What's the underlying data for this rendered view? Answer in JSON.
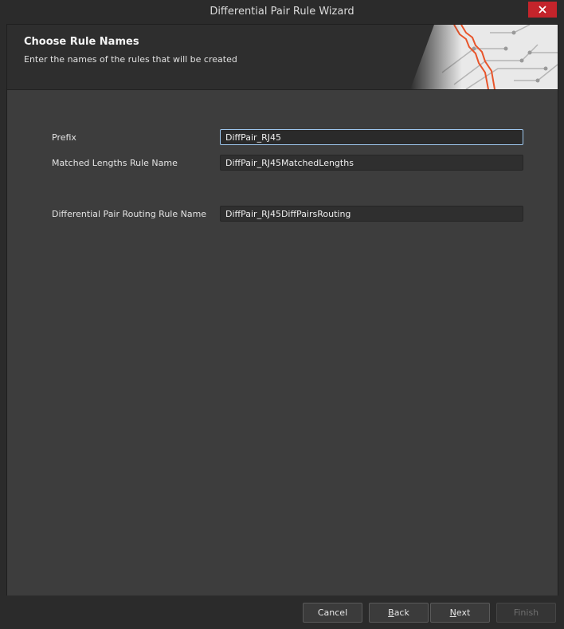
{
  "window": {
    "title": "Differential Pair Rule Wizard"
  },
  "header": {
    "title": "Choose Rule Names",
    "subtitle": "Enter the names of the rules that will be created"
  },
  "fields": {
    "prefix": {
      "label": "Prefix",
      "value": "DiffPair_RJ45"
    },
    "matched_lengths": {
      "label": "Matched Lengths Rule Name",
      "value": "DiffPair_RJ45MatchedLengths"
    },
    "diff_pair_routing": {
      "label": "Differential Pair Routing Rule Name",
      "value": "DiffPair_RJ45DiffPairsRouting"
    }
  },
  "buttons": {
    "cancel": "Cancel",
    "back_first": "B",
    "back_rest": "ack",
    "next_first": "N",
    "next_rest": "ext",
    "finish": "Finish"
  },
  "colors": {
    "accent_close": "#c4242b",
    "circuit_accent": "#e8542a",
    "focus_border": "#9ec7ee"
  },
  "icons": {
    "close": "close-icon",
    "header_art": "circuit-board-art"
  }
}
